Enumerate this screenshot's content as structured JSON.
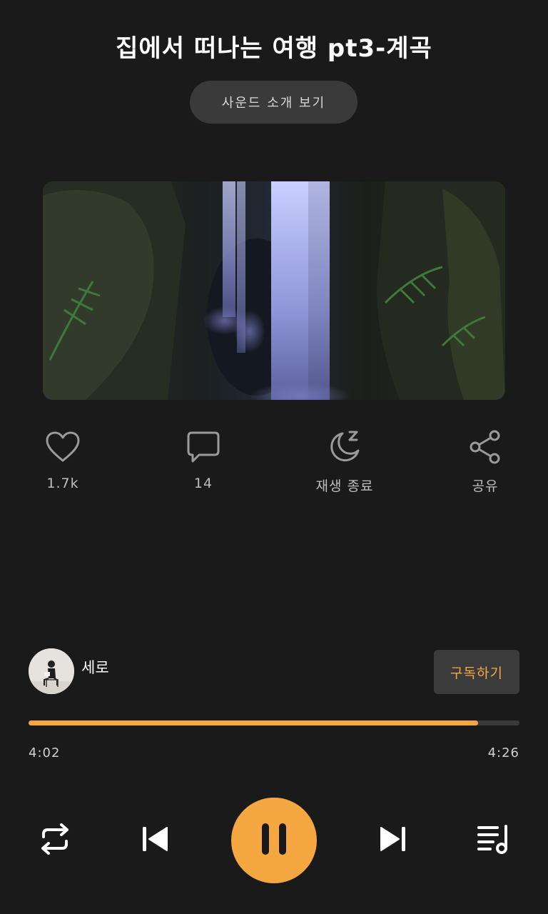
{
  "track": {
    "title": "집에서 떠나는 여행 pt3-계곡",
    "sound_intro_label": "사운드 소개 보기"
  },
  "actions": {
    "like_count": "1.7k",
    "comment_count": "14",
    "sleep_timer_label": "재생 종료",
    "share_label": "공유"
  },
  "artist": {
    "name": "세로",
    "subscribe_label": "구독하기"
  },
  "player": {
    "current_time": "4:02",
    "total_time": "4:26",
    "progress": 0.915,
    "state": "playing"
  },
  "colors": {
    "accent": "#f5a742",
    "background": "#1a1a1a",
    "button_bg": "#3a3a3a"
  },
  "icons": {
    "like": "heart-icon",
    "comment": "speech-bubble-icon",
    "sleep": "moon-z-icon",
    "share": "share-icon",
    "repeat": "repeat-icon",
    "previous": "skip-previous-icon",
    "pause": "pause-icon",
    "next": "skip-next-icon",
    "playlist": "playlist-icon"
  }
}
